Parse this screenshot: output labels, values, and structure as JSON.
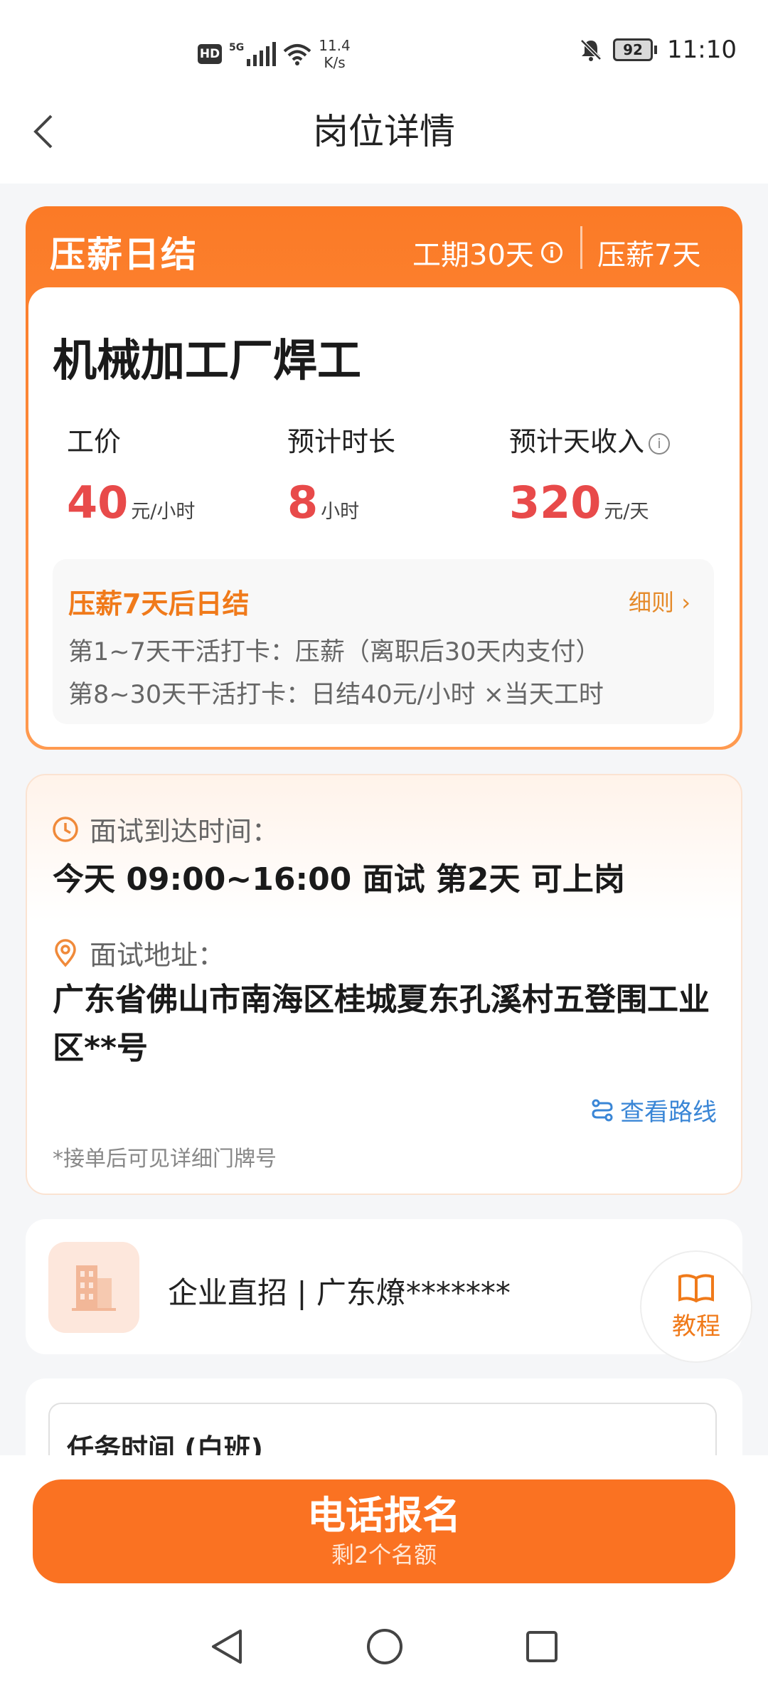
{
  "status_bar": {
    "hd": "HD",
    "network": "5G",
    "speed_value": "11.4",
    "speed_unit": "K/s",
    "battery": "92",
    "time": "11:10"
  },
  "header": {
    "title": "岗位详情"
  },
  "job_card": {
    "tag": "压薪日结",
    "period": "工期30天",
    "withhold": "压薪7天",
    "job_title": "机械加工厂焊工",
    "stats": [
      {
        "label": "工价",
        "value": "40",
        "unit": "元/小时"
      },
      {
        "label": "预计时长",
        "value": "8",
        "unit": "小时"
      },
      {
        "label": "预计天收入",
        "value": "320",
        "unit": "元/天"
      }
    ],
    "rule": {
      "title": "压薪7天后日结",
      "link": "细则",
      "line1": "第1~7天干活打卡：压薪（离职后30天内支付）",
      "line2": "第8~30天干活打卡：日结40元/小时 ×当天工时"
    }
  },
  "interview": {
    "time_label": "面试到达时间：",
    "time_value": "今天 09:00~16:00 面试 第2天 可上岗",
    "address_label": "面试地址：",
    "address_value": "广东省佛山市南海区桂城夏东孔溪村五登围工业区**号",
    "route": "查看路线",
    "note": "*接单后可见详细门牌号"
  },
  "company": {
    "name": "企业直招 | 广东燎*******",
    "guide": "教程"
  },
  "task": {
    "title": "任务时间 (白班)"
  },
  "cta": {
    "label": "电话报名",
    "sub": "剩2个名额"
  },
  "colors": {
    "accent": "#fa7222",
    "price": "#e84a4a",
    "link": "#3a86d6"
  }
}
